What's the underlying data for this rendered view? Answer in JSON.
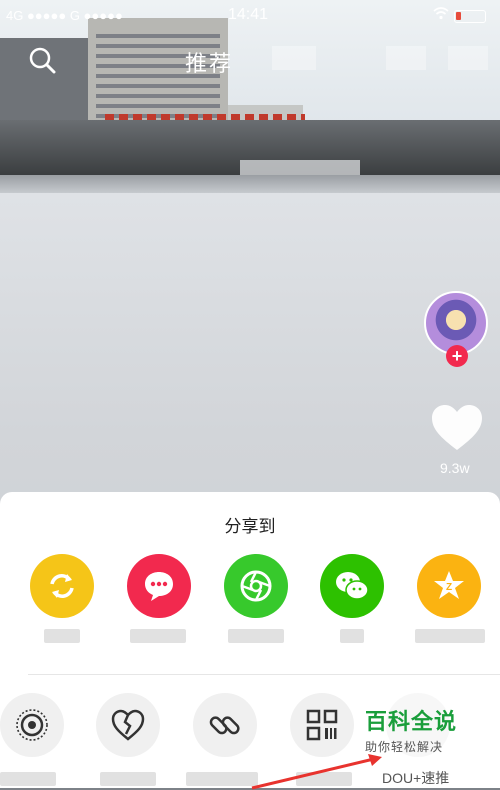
{
  "status_bar": {
    "carrier": "4G ●●●●● G ●●●●●",
    "time": "14:41",
    "battery_level": 0.2,
    "battery_color": "#e74c3c"
  },
  "top_bar": {
    "title": "推荐",
    "search_icon": "search-icon"
  },
  "right_rail": {
    "like_count": "9.3w",
    "follow_symbol": "+",
    "follow_color": "#f2294e"
  },
  "share_sheet": {
    "title": "分享到",
    "row1": [
      {
        "icon": "repost-icon",
        "color": "#f5c518"
      },
      {
        "icon": "message-icon",
        "color": "#f2294e"
      },
      {
        "icon": "shutter-icon",
        "color": "#37c92c"
      },
      {
        "icon": "wechat-icon",
        "color": "#2dc100"
      },
      {
        "icon": "qzone-icon",
        "color": "#fbb311"
      }
    ],
    "row2": [
      {
        "icon": "live-photo-icon"
      },
      {
        "icon": "broken-heart-icon"
      },
      {
        "icon": "link-icon"
      },
      {
        "icon": "qr-code-icon"
      }
    ],
    "dou_label": "DOU+速推"
  },
  "watermark": {
    "title": "百科全说",
    "subtitle": "助你轻松解决"
  }
}
